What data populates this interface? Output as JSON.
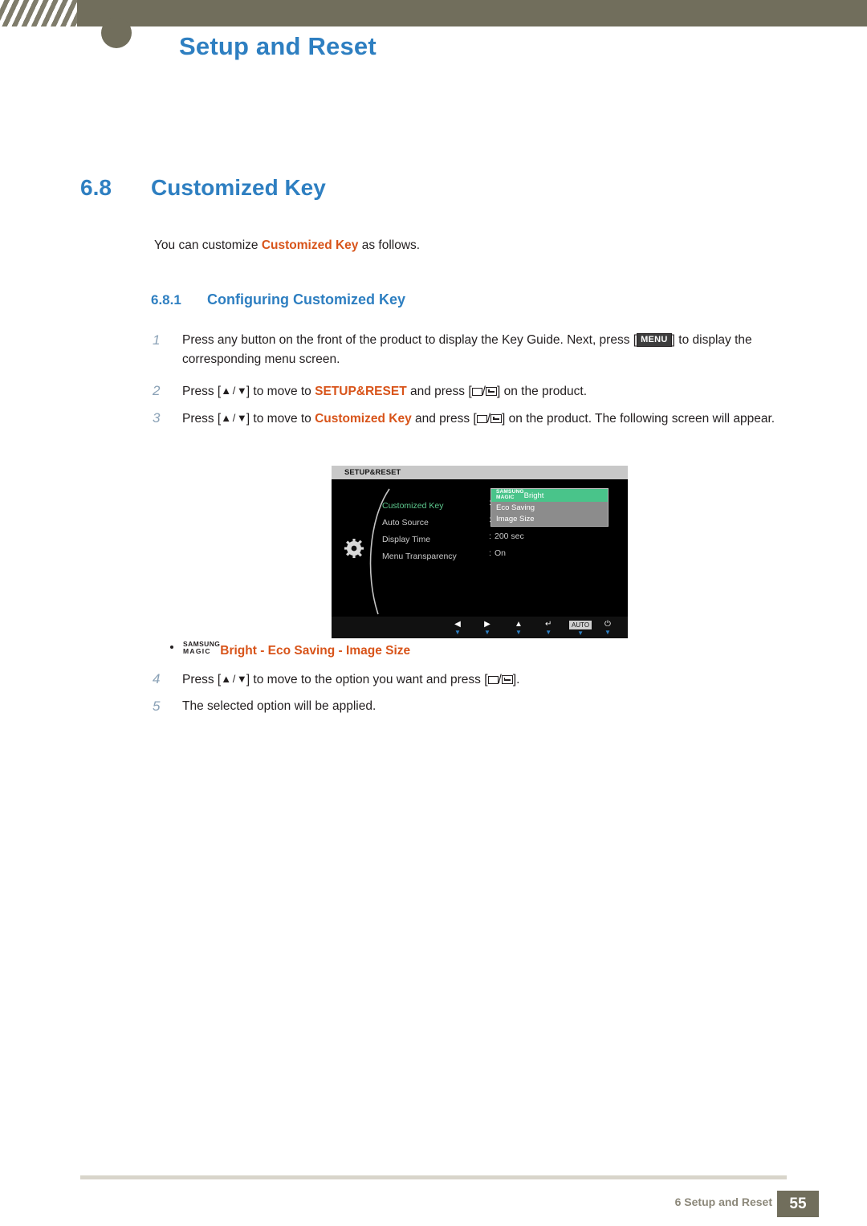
{
  "header": {
    "title": "Setup and Reset"
  },
  "section": {
    "number": "6.8",
    "title": "Customized Key",
    "intro_pre": "You can customize ",
    "intro_hl": "Customized Key",
    "intro_post": " as follows."
  },
  "subsection": {
    "number": "6.8.1",
    "title": "Configuring Customized Key"
  },
  "steps": [
    {
      "num": "1",
      "pre": "Press any button on the front of the product to display the Key Guide. Next, press [",
      "key": "MENU",
      "post": "] to display the corresponding menu screen."
    },
    {
      "num": "2",
      "pre": "Press [",
      "arrows": "▲ / ▼",
      "mid": "] to move to ",
      "hl": "SETUP&RESET",
      "mid2": " and press [",
      "post": "] on the product."
    },
    {
      "num": "3",
      "pre": "Press [",
      "arrows": "▲ / ▼",
      "mid": "] to move to ",
      "hl": "Customized Key",
      "mid2": " and press [",
      "post": "] on the product. The following screen will appear."
    },
    {
      "num": "4",
      "pre": "Press [",
      "arrows": "▲ / ▼",
      "mid": "] to move to the option you want and press [",
      "post": "]."
    },
    {
      "num": "5",
      "text": "The selected option will be applied."
    }
  ],
  "osd": {
    "title": "SETUP&RESET",
    "items": [
      {
        "label": "Customized Key",
        "colon": ":",
        "value": ""
      },
      {
        "label": "Auto Source",
        "colon": ":",
        "value": ""
      },
      {
        "label": "Display Time",
        "colon": ":",
        "value": "200 sec"
      },
      {
        "label": "Menu Transparency",
        "colon": ":",
        "value": "On"
      }
    ],
    "submenu": {
      "selected_line1": "SAMSUNG",
      "selected_line2": "MAGIC",
      "selected_label": "Bright",
      "options": [
        "Eco Saving",
        "Image Size"
      ]
    },
    "buttons": [
      {
        "glyph": "◀",
        "label": ""
      },
      {
        "glyph": "▶",
        "label": ""
      },
      {
        "glyph": "▲",
        "label": ""
      },
      {
        "glyph": "↵",
        "label": ""
      },
      {
        "glyph": "",
        "label": "AUTO"
      },
      {
        "glyph": "⏻",
        "label": ""
      }
    ]
  },
  "bullet": {
    "brand_line1": "SAMSUNG",
    "brand_line2": "MAGIC",
    "text1": "Bright",
    "sep1": " - ",
    "text2": "Eco Saving",
    "sep2": " - ",
    "text3": "Image Size"
  },
  "footer": {
    "text": "6 Setup and Reset",
    "page": "55"
  },
  "colors": {
    "accent_blue": "#2e7fc1",
    "accent_orange": "#d8541a",
    "header_olive": "#716e5c",
    "osd_green": "#49c48a"
  }
}
